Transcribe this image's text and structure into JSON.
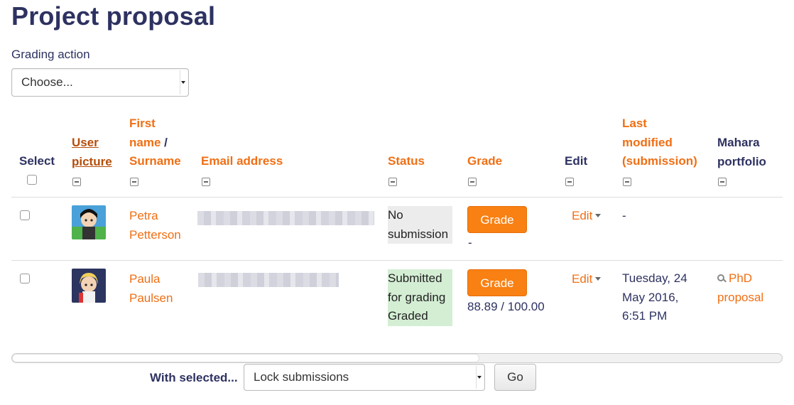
{
  "page": {
    "title": "Project proposal"
  },
  "grading_action": {
    "label": "Grading action",
    "selected": "Choose..."
  },
  "columns": {
    "select": "Select",
    "user_picture": [
      "User",
      "picture"
    ],
    "name": [
      "First",
      "name",
      "/",
      "Surname"
    ],
    "email": "Email address",
    "status": "Status",
    "grade": "Grade",
    "edit": "Edit",
    "last_modified": [
      "Last",
      "modified",
      "(submission)"
    ],
    "mahara": [
      "Mahara",
      "portfolio"
    ]
  },
  "rows": [
    {
      "first_name": "Petra",
      "surname": "Petterson",
      "status_lines": [
        "No",
        "submission"
      ],
      "grade_button": "Grade",
      "grade_value": "-",
      "edit": "Edit",
      "last_modified": "-",
      "mahara": ""
    },
    {
      "first_name": "Paula",
      "surname": "Paulsen",
      "status_lines": [
        "Submitted",
        "for grading",
        "Graded"
      ],
      "grade_button": "Grade",
      "grade_value": "88.89 / 100.00",
      "edit": "Edit",
      "last_modified_lines": [
        "Tuesday, 24",
        "May 2016,",
        "6:51 PM"
      ],
      "mahara_lines": [
        "PhD",
        "proposal"
      ]
    }
  ],
  "bulk": {
    "label": "With selected...",
    "selected": "Lock submissions",
    "go": "Go"
  },
  "colors": {
    "accent": "#f06f14",
    "button": "#f98012",
    "heading": "#2e3261",
    "submitted_bg": "#d4eed4",
    "nosub_bg": "#ececec"
  },
  "icons": [
    "collapse-column-icon",
    "dropdown-caret-icon",
    "magnifier-icon",
    "checkbox"
  ]
}
